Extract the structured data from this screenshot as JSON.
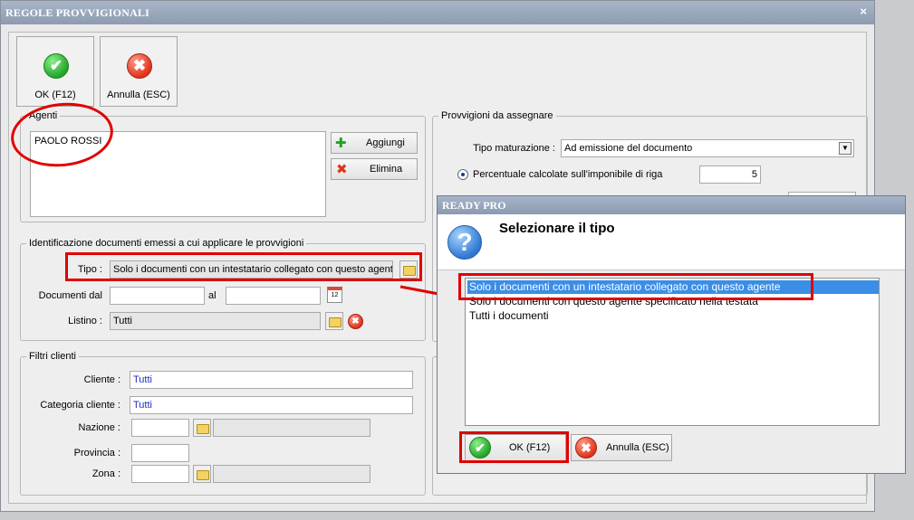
{
  "window": {
    "title": "REGOLE PROVVIGIONALI",
    "close_glyph": "×"
  },
  "toolbar": {
    "ok_label": "OK (F12)",
    "cancel_label": "Annulla (ESC)"
  },
  "agents": {
    "legend": "Agenti",
    "items": [
      "PAOLO ROSSI"
    ],
    "add_label": "Aggiungi",
    "remove_label": "Elimina"
  },
  "identification": {
    "legend": "Identificazione documenti emessi a cui applicare le provvigioni",
    "tipo_label": "Tipo :",
    "tipo_value": "Solo i documenti con un intestatario collegato con questo agente",
    "date_from_label": "Documenti dal",
    "date_from_value": "",
    "date_to_label": "al",
    "date_to_value": "",
    "calendar_text": "12",
    "listino_label": "Listino :",
    "listino_value": "Tutti"
  },
  "customer_filters": {
    "legend": "Filtri clienti",
    "cliente_label": "Cliente :",
    "cliente_value": "Tutti",
    "categoria_label": "Categoria cliente :",
    "categoria_value": "Tutti",
    "nazione_label": "Nazione :",
    "provincia_label": "Provincia :",
    "zona_label": "Zona :"
  },
  "commissions": {
    "legend": "Provvigioni da assegnare",
    "maturazione_label": "Tipo maturazione :",
    "maturazione_value": "Ad emissione del documento",
    "percent_label": "Percentuale calcolate sull'imponibile di riga",
    "percent_value": "5"
  },
  "dialog": {
    "title": "READY PRO",
    "question": "Selezionare il tipo",
    "options": [
      "Solo i documenti con un intestatario collegato con questo agente",
      "Solo i documenti con questo agente specificato nella testata",
      "Tutti i documenti"
    ],
    "selected_index": 0,
    "ok_label": "OK (F12)",
    "cancel_label": "Annulla (ESC)"
  },
  "icons": {
    "check": "✔",
    "cross": "✖",
    "plus": "✚",
    "question": "?"
  },
  "colors": {
    "highlight": "#e00000",
    "selection": "#3a8ee6",
    "link_text": "#1a2ec8"
  }
}
